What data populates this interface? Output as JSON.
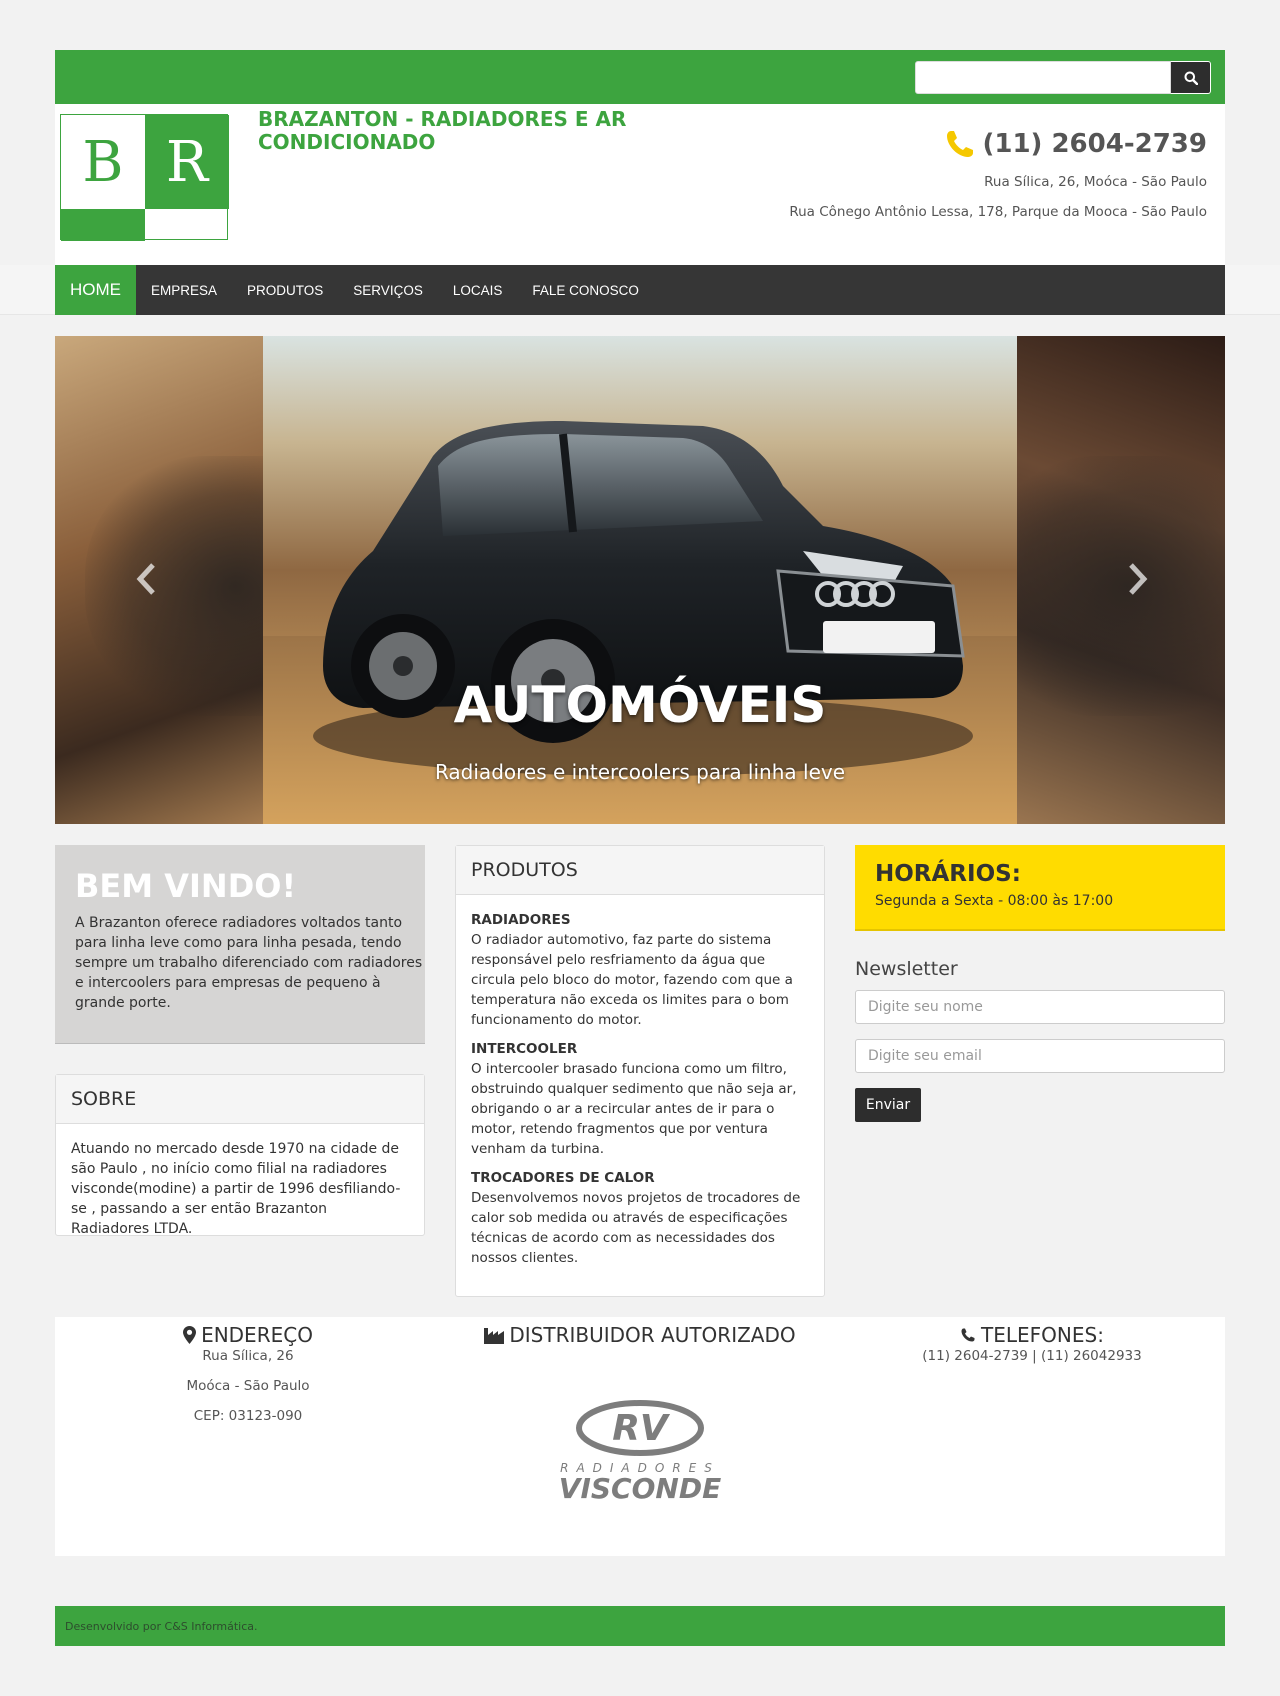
{
  "search": {
    "placeholder": ""
  },
  "header": {
    "logo_left": "B",
    "logo_right": "R",
    "company_name": "BRAZANTON - RADIADORES E AR CONDICIONADO",
    "phone": "(11) 2604-2739",
    "address_1": "Rua Sílica, 26, Moóca - São Paulo",
    "address_2": "Rua Cônego Antônio Lessa, 178, Parque da Mooca - São Paulo"
  },
  "nav": {
    "items": [
      {
        "label": "HOME",
        "active": true
      },
      {
        "label": "EMPRESA"
      },
      {
        "label": "PRODUTOS"
      },
      {
        "label": "SERVIÇOS"
      },
      {
        "label": "LOCAIS"
      },
      {
        "label": "FALE CONOSCO"
      }
    ]
  },
  "carousel": {
    "title": "AUTOMÓVEIS",
    "subtitle": "Radiadores e intercoolers para linha leve"
  },
  "welcome": {
    "title": "BEM VINDO!",
    "text": "A Brazanton oferece radiadores voltados tanto para linha leve como para linha pesada, tendo sempre um trabalho diferenciado com radiadores e intercoolers para empresas de pequeno à grande porte."
  },
  "sobre": {
    "title": "SOBRE",
    "text": "Atuando no mercado desde 1970 na cidade de são Paulo , no início como filial na radiadores visconde(modine) a partir de 1996 desfiliando-se , passando a ser então Brazanton Radiadores LTDA."
  },
  "produtos": {
    "title": "PRODUTOS",
    "items": [
      {
        "name": "RADIADORES",
        "text": "O radiador automotivo, faz parte do sistema responsável pelo resfriamento da água que circula pelo bloco do motor, fazendo com que a temperatura não exceda os limites para o bom funcionamento do motor."
      },
      {
        "name": "INTERCOOLER",
        "text": "O intercooler brasado funciona como um filtro, obstruindo qualquer sedimento que não seja ar, obrigando o ar a recircular antes de ir para o motor, retendo fragmentos que por ventura venham da turbina."
      },
      {
        "name": "TROCADORES DE CALOR",
        "text": "Desenvolvemos novos projetos de trocadores de calor sob medida ou através de especificações técnicas de acordo com as necessidades dos nossos clientes."
      }
    ]
  },
  "horarios": {
    "title": "HORÁRIOS:",
    "text": "Segunda a Sexta - 08:00 às 17:00"
  },
  "newsletter": {
    "title": "Newsletter",
    "name_placeholder": "Digite seu nome",
    "email_placeholder": "Digite seu email",
    "submit_label": "Enviar"
  },
  "footer": {
    "endereco_title": "ENDEREÇO",
    "endereco_lines": [
      "Rua Sílica, 26",
      "Moóca - São Paulo",
      "CEP: 03123-090"
    ],
    "distribuidor_title": "DISTRIBUIDOR AUTORIZADO",
    "brand_mark": "RV",
    "brand_top": "RADIADORES",
    "brand_bottom": "VISCONDE",
    "telefones_title": "TELEFONES:",
    "telefones_text": "(11) 2604-2739 | (11) 26042933",
    "credit": "Desenvolvido por C&S Informática."
  },
  "colors": {
    "brand_green": "#3da43f",
    "accent_yellow": "#ffdc00",
    "dark": "#363636"
  },
  "icons": [
    "search-icon",
    "phone-icon",
    "chevron-left-icon",
    "chevron-right-icon",
    "map-marker-icon",
    "industry-icon",
    "phone-small-icon"
  ]
}
